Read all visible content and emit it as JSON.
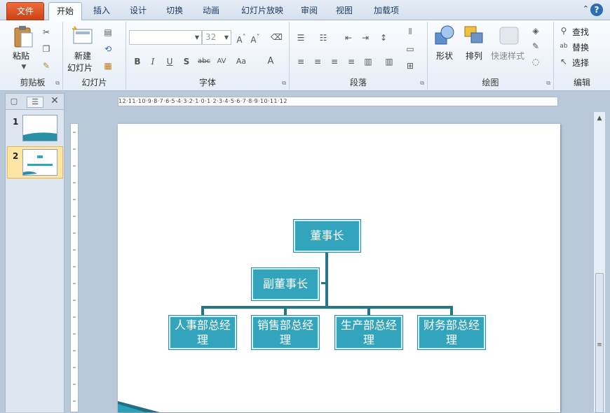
{
  "tabs": [
    "文件",
    "开始",
    "插入",
    "设计",
    "切换",
    "动画",
    "幻灯片放映",
    "审阅",
    "视图",
    "加载项"
  ],
  "ribbon": {
    "clipboard": {
      "paste": "粘贴",
      "label": "剪贴板"
    },
    "slides": {
      "new_slide_1": "新建",
      "new_slide_2": "幻灯片",
      "label": "幻灯片"
    },
    "font": {
      "font_name": "",
      "font_size": "32",
      "label": "字体"
    },
    "paragraph": {
      "label": "段落"
    },
    "drawing": {
      "shapes": "形状",
      "arrange": "排列",
      "quick_styles": "快速样式",
      "label": "绘图"
    },
    "editing": {
      "find": "查找",
      "replace": "替换",
      "select": "选择",
      "label": "编辑"
    }
  },
  "thumbnails": [
    "1",
    "2"
  ],
  "ruler_text": "12·11·10·9·8·7·6·5·4·3·2·1·0·1·2·3·4·5·6·7·8·9·10·11·12",
  "org_chart": {
    "chairman": "董事长",
    "vice_chairman": "副董事长",
    "managers": [
      [
        "人事部总经",
        "理"
      ],
      [
        "销售部总经",
        "理"
      ],
      [
        "生产部总经",
        "理"
      ],
      [
        "财务部总经",
        "理"
      ]
    ]
  },
  "colors": {
    "box": "#32a5bd",
    "connector": "#277588",
    "file_tab": "#e55a24"
  }
}
